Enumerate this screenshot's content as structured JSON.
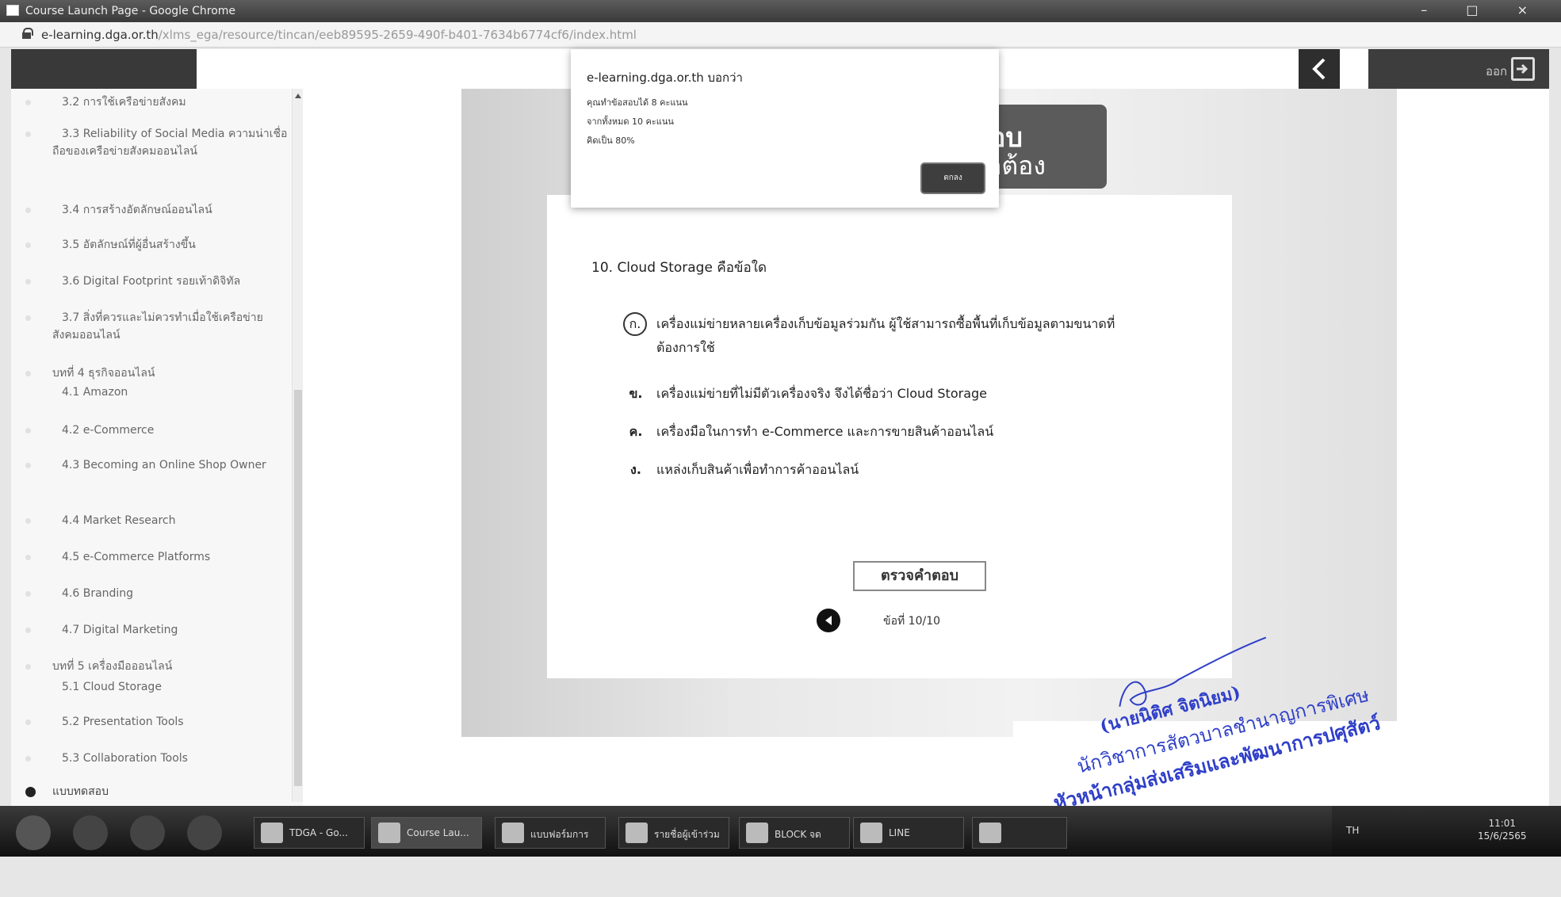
{
  "window": {
    "title": "Course Launch Page - Google Chrome",
    "controls": "– □ ×"
  },
  "address": {
    "url_main": "e-learning.dga.or.th",
    "url_rest": "/xlms_ega/resource/tincan/eeb89595-2659-490f-b401-7634b6774cf6/index.html"
  },
  "header": {
    "exit_label": "ออก"
  },
  "sidebar": {
    "items": [
      {
        "text": "3.2 การใช้เครือข่ายสังคม"
      },
      {
        "text": "3.3 Reliability of Social Media ความน่าเชื่อถือของเครือข่ายสังคมออนไลน์"
      },
      {
        "text": "3.4 การสร้างอัตลักษณ์ออนไลน์"
      },
      {
        "text": "3.5 อัตลักษณ์ที่ผู้อื่นสร้างขึ้น"
      },
      {
        "text": "3.6 Digital Footprint รอยเท้าดิจิทัล"
      },
      {
        "text": "3.7 สิ่งที่ควรและไม่ควรทำเมื่อใช้เครือข่ายสังคมออนไลน์"
      },
      {
        "text": "บทที่ 4 ธุรกิจออนไลน์"
      },
      {
        "text": "4.1 Amazon"
      },
      {
        "text": "4.2 e-Commerce"
      },
      {
        "text": "4.3 Becoming an Online Shop Owner"
      },
      {
        "text": "4.4 Market Research"
      },
      {
        "text": "4.5 e-Commerce Platforms"
      },
      {
        "text": "4.6 Branding"
      },
      {
        "text": "4.7 Digital Marketing"
      },
      {
        "text": "บทที่ 5 เครื่องมือออนไลน์"
      },
      {
        "text": "5.1 Cloud Storage"
      },
      {
        "text": "5.2 Presentation Tools"
      },
      {
        "text": "5.3 Collaboration Tools"
      },
      {
        "text": "แบบทดสอบ"
      }
    ]
  },
  "slide": {
    "banner_line1": "อบ",
    "banner_line2": "ูกต้อง",
    "question": "10. Cloud Storage คือข้อใด",
    "choices": [
      {
        "key": "ก.",
        "text": "เครื่องแม่ข่ายหลายเครื่องเก็บข้อมูลร่วมกัน ผู้ใช้สามารถซื้อพื้นที่เก็บข้อมูลตามขนาดที่ต้องการใช้"
      },
      {
        "key": "ข.",
        "text": "เครื่องแม่ข่ายที่ไม่มีตัวเครื่องจริง จึงได้ชื่อว่า Cloud Storage"
      },
      {
        "key": "ค.",
        "text": "เครื่องมือในการทำ e-Commerce และการขายสินค้าออนไลน์"
      },
      {
        "key": "ง.",
        "text": "แหล่งเก็บสินค้าเพื่อทำการค้าออนไลน์"
      }
    ],
    "selected_choice": "ก.",
    "check_button": "ตรวจคำตอบ",
    "counter": "ข้อที่ 10/10"
  },
  "dialog": {
    "title": "e-learning.dga.or.th บอกว่า",
    "lines": [
      "คุณทำข้อสอบได้ 8 คะแนน",
      "จากทั้งหมด 10 คะแนน",
      "คิดเป็น 80%"
    ],
    "ok_button": "ตกลง"
  },
  "stamp": {
    "name": "(นายนิติศ จิตนิยม)",
    "position": "นักวิชาการสัตวบาลชำนาญการพิเศษ",
    "unit": "หัวหน้ากลุ่มส่งเสริมและพัฒนาการปศุสัตว์"
  },
  "taskbar": {
    "apps": [
      {
        "label": "TDGA - Go..."
      },
      {
        "label": "Course Lau..."
      },
      {
        "label": "แบบฟอร์มการ"
      },
      {
        "label": "รายชื่อผู้เข้าร่วม"
      },
      {
        "label": "BLOCK จด"
      },
      {
        "label": "LINE"
      }
    ],
    "lang": "TH",
    "time": "11:01",
    "date": "15/6/2565"
  },
  "colors": {
    "header_dark": "#393939",
    "stamp_blue": "#2f3fc8",
    "dialog_button": "#3e3e3e"
  }
}
